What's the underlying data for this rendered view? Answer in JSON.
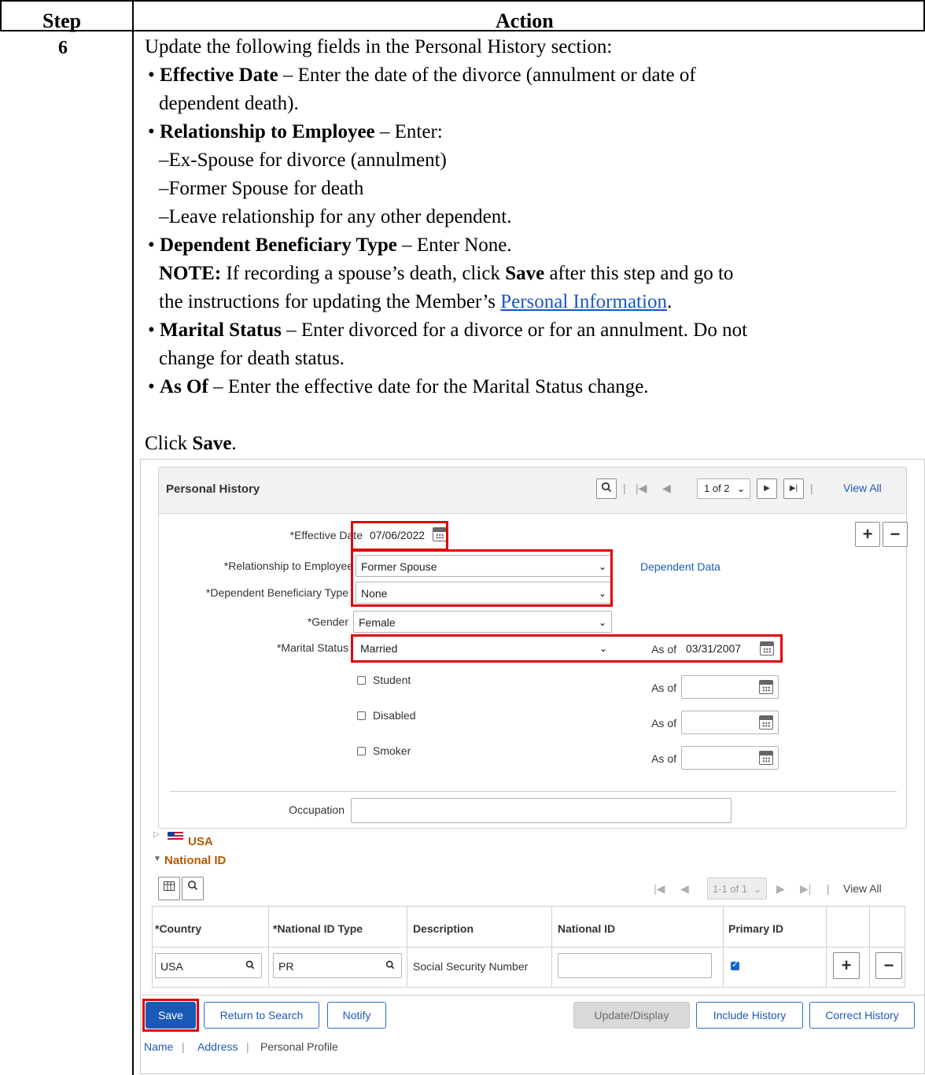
{
  "table": {
    "header_step": "Step",
    "header_action": "Action",
    "step_number": "6",
    "intro": "Update the following fields in the Personal History section:",
    "b1_label": "Effective Date",
    "b1_text_a": " – Enter the date of the divorce (annulment or date of",
    "b1_text_b": "dependent death).",
    "b2_label": "Relationship to Employee",
    "b2_text": " – Enter:",
    "b2_sub1": "–Ex-Spouse for divorce (annulment)",
    "b2_sub2": "–Former Spouse for death",
    "b2_sub3": "–Leave relationship for any other dependent.",
    "b3_label": "Dependent Beneficiary Type",
    "b3_text": " – Enter None.",
    "note_label": "NOTE:",
    "note_text_a": " If recording a spouse’s death, click ",
    "note_save": "Save",
    "note_text_b": " after this step and go to",
    "note_text_c": "the instructions for updating the Member’s ",
    "note_link": "Personal Information",
    "note_text_d": ".",
    "b4_label": "Marital Status",
    "b4_text_a": " – Enter divorced for a divorce or for an annulment. Do not",
    "b4_text_b": "change for death status.",
    "b5_label": "As Of",
    "b5_text": " – Enter the effective date for the Marital Status change.",
    "click_prefix": "Click ",
    "click_save": "Save",
    "click_suffix": "."
  },
  "screenshot": {
    "group_title": "Personal History",
    "nav_count": "1 of 2",
    "view_all": "View All",
    "effective_date_label": "*Effective Date",
    "effective_date_value": "07/06/2022",
    "relationship_label": "*Relationship to Employee",
    "relationship_value": "Former Spouse",
    "dependent_data_link": "Dependent Data",
    "beneficiary_label": "*Dependent Beneficiary Type",
    "beneficiary_value": "None",
    "gender_label": "*Gender",
    "gender_value": "Female",
    "marital_label": "*Marital Status",
    "marital_value": "Married",
    "as_of_label": "As of",
    "marital_as_of_value": "03/31/2007",
    "student_label": "Student",
    "disabled_label": "Disabled",
    "smoker_label": "Smoker",
    "occupation_label": "Occupation",
    "usa_label": "USA",
    "national_id_section": "National ID",
    "grid_count": "1-1 of 1",
    "grid_view_all": "View All",
    "col_country": "*Country",
    "col_id_type": "*National ID Type",
    "col_description": "Description",
    "col_national_id": "National ID",
    "col_primary": "Primary ID",
    "row_country": "USA",
    "row_id_type": "PR",
    "row_description": "Social Security Number",
    "btn_save": "Save",
    "btn_return": "Return to Search",
    "btn_notify": "Notify",
    "btn_update": "Update/Display",
    "btn_include": "Include History",
    "btn_correct": "Correct History",
    "link_name": "Name",
    "link_address": "Address",
    "link_profile": "Personal Profile",
    "accent_color": "#e00000",
    "link_color": "#1d5ab9"
  }
}
